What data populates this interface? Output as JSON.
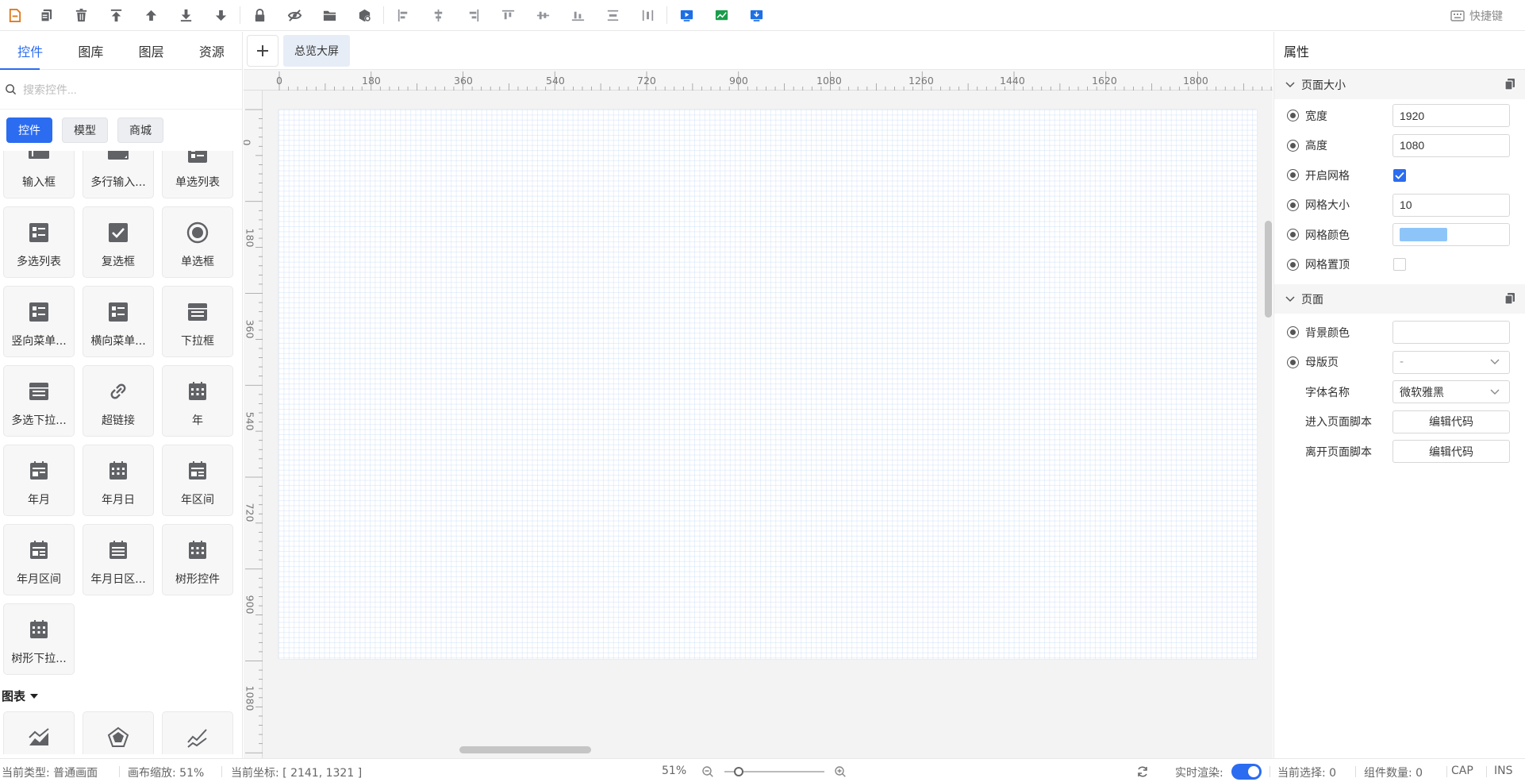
{
  "toolbar": {
    "icons": [
      "file-icon",
      "copy-icon",
      "delete-icon",
      "move-top-icon",
      "move-up-icon",
      "move-down-icon",
      "move-bottom-icon",
      "lock-icon",
      "hide-icon",
      "folder-icon",
      "component-settings-icon",
      "align-left-icon",
      "align-center-icon",
      "align-right-icon",
      "align-top-icon",
      "align-middle-icon",
      "align-bottom-icon",
      "distribute-horizontal-icon",
      "distribute-vertical-icon",
      "preview-icon",
      "chart-icon",
      "publish-icon"
    ],
    "shortcut_label": "快捷键"
  },
  "left_panel": {
    "tabs": [
      "控件",
      "图库",
      "图层",
      "资源"
    ],
    "active_tab": "控件",
    "search_placeholder": "搜索控件...",
    "categories": [
      "控件",
      "模型",
      "商城"
    ],
    "controls": [
      {
        "label": "输入框",
        "icon": "input-icon"
      },
      {
        "label": "多行输入...",
        "icon": "textarea-icon"
      },
      {
        "label": "单选列表",
        "icon": "list-icon"
      },
      {
        "label": "多选列表",
        "icon": "list-icon"
      },
      {
        "label": "复选框",
        "icon": "checkbox-icon"
      },
      {
        "label": "单选框",
        "icon": "radio-icon"
      },
      {
        "label": "竖向菜单...",
        "icon": "list-icon"
      },
      {
        "label": "横向菜单...",
        "icon": "list-icon"
      },
      {
        "label": "下拉框",
        "icon": "dropdown-icon"
      },
      {
        "label": "多选下拉...",
        "icon": "dropdown-icon"
      },
      {
        "label": "超链接",
        "icon": "link-icon"
      },
      {
        "label": "年",
        "icon": "calendar-icon"
      },
      {
        "label": "年月",
        "icon": "calendar-icon"
      },
      {
        "label": "年月日",
        "icon": "calendar-icon"
      },
      {
        "label": "年区间",
        "icon": "calendar-range-icon"
      },
      {
        "label": "年月区间",
        "icon": "calendar-range-icon"
      },
      {
        "label": "年月日区...",
        "icon": "calendar-range-icon"
      },
      {
        "label": "树形控件",
        "icon": "calendar-icon"
      },
      {
        "label": "树形下拉...",
        "icon": "calendar-icon"
      }
    ],
    "chart_section": "图表"
  },
  "center": {
    "page_tab": "总览大屏",
    "h_ticks": [
      "0",
      "180",
      "360",
      "540",
      "720",
      "900",
      "1080",
      "1260",
      "1440",
      "1620",
      "1800"
    ],
    "v_ticks": [
      "0",
      "180",
      "360",
      "540",
      "720",
      "900",
      "1080"
    ]
  },
  "right_panel": {
    "title": "属性",
    "section_page_size": "页面大小",
    "width_label": "宽度",
    "width_value": "1920",
    "height_label": "高度",
    "height_value": "1080",
    "grid_enable_label": "开启网格",
    "grid_enabled": true,
    "grid_size_label": "网格大小",
    "grid_size_value": "10",
    "grid_color_label": "网格颜色",
    "grid_color": "#8ec5f8",
    "grid_top_label": "网格置顶",
    "grid_top": false,
    "section_page": "页面",
    "bg_color_label": "背景颜色",
    "master_label": "母版页",
    "master_value": "-",
    "font_label": "字体名称",
    "font_value": "微软雅黑",
    "enter_script_label": "进入页面脚本",
    "leave_script_label": "离开页面脚本",
    "edit_code": "编辑代码"
  },
  "status": {
    "type_label": "当前类型:",
    "type_value": "普通画面",
    "zoom_label": "画布缩放:",
    "zoom_value": "51%",
    "coord_label": "当前坐标:",
    "coord_value": "[ 2141, 1321 ]",
    "zoom_center": "51%",
    "zoom_level": 0.51,
    "realtime_label": "实时渲染:",
    "selection_label": "当前选择:",
    "selection_value": "0",
    "count_label": "组件数量:",
    "count_value": "0",
    "cap": "CAP",
    "ins": "INS"
  },
  "colors": {
    "accent": "#2b6cf0",
    "icon": "#606266",
    "tool_blue": "#1d6fe5",
    "tool_green": "#1a9d4a",
    "file_orange": "#e07a1f"
  }
}
